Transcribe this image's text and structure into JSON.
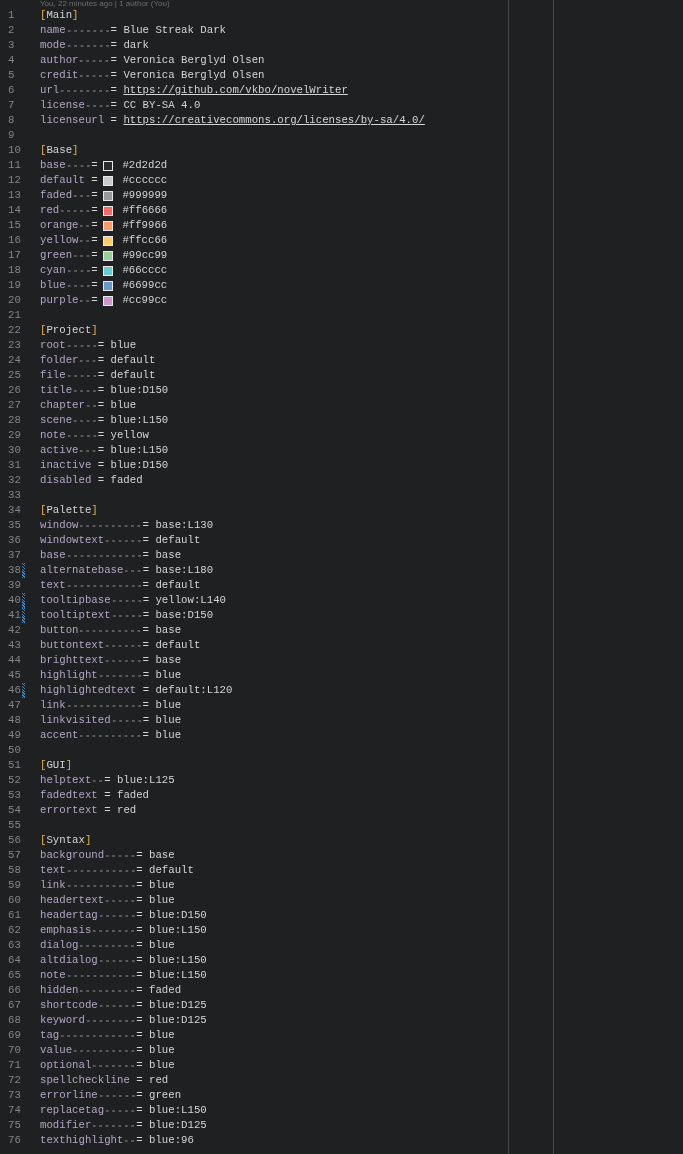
{
  "blame_hint": "You, 22 minutes ago | 1 author (You)",
  "lines": [
    {
      "number": "1",
      "kind": "section",
      "open": "[",
      "name": "Main",
      "close": "]",
      "modified": false
    },
    {
      "number": "2",
      "kind": "pair",
      "key": "name",
      "op": "=",
      "value": "Blue Streak Dark",
      "link": false,
      "modified": false
    },
    {
      "number": "3",
      "kind": "pair",
      "key": "mode",
      "op": "=",
      "value": "dark",
      "link": false,
      "modified": false
    },
    {
      "number": "4",
      "kind": "pair",
      "key": "author",
      "op": "=",
      "value": "Veronica Berglyd Olsen",
      "link": false,
      "modified": false
    },
    {
      "number": "5",
      "kind": "pair",
      "key": "credit",
      "op": "=",
      "value": "Veronica Berglyd Olsen",
      "link": false,
      "modified": false
    },
    {
      "number": "6",
      "kind": "pair",
      "key": "url",
      "op": "=",
      "value": "https://github.com/vkbo/novelWriter",
      "link": true,
      "modified": false
    },
    {
      "number": "7",
      "kind": "pair",
      "key": "license",
      "op": "=",
      "value": "CC BY-SA 4.0",
      "link": false,
      "modified": false
    },
    {
      "number": "8",
      "kind": "pair",
      "key": "licenseurl",
      "op": "=",
      "value": "https://creativecommons.org/licenses/by-sa/4.0/",
      "link": true,
      "modified": false
    },
    {
      "number": "9",
      "kind": "blank",
      "modified": false
    },
    {
      "number": "10",
      "kind": "section",
      "open": "[",
      "name": "Base",
      "close": "]",
      "modified": false
    },
    {
      "number": "11",
      "kind": "pair",
      "key": "base",
      "op": "=",
      "value": "#2d2d2d",
      "color": "#2d2d2d",
      "link": false,
      "modified": false
    },
    {
      "number": "12",
      "kind": "pair",
      "key": "default",
      "op": "=",
      "value": "#cccccc",
      "color": "#cccccc",
      "link": false,
      "modified": false
    },
    {
      "number": "13",
      "kind": "pair",
      "key": "faded",
      "op": "=",
      "value": "#999999",
      "color": "#999999",
      "link": false,
      "modified": false
    },
    {
      "number": "14",
      "kind": "pair",
      "key": "red",
      "op": "=",
      "value": "#ff6666",
      "color": "#ff6666",
      "link": false,
      "modified": false
    },
    {
      "number": "15",
      "kind": "pair",
      "key": "orange",
      "op": "=",
      "value": "#ff9966",
      "color": "#ff9966",
      "link": false,
      "modified": false
    },
    {
      "number": "16",
      "kind": "pair",
      "key": "yellow",
      "op": "=",
      "value": "#ffcc66",
      "color": "#ffcc66",
      "link": false,
      "modified": false
    },
    {
      "number": "17",
      "kind": "pair",
      "key": "green",
      "op": "=",
      "value": "#99cc99",
      "color": "#99cc99",
      "link": false,
      "modified": false
    },
    {
      "number": "18",
      "kind": "pair",
      "key": "cyan",
      "op": "=",
      "value": "#66cccc",
      "color": "#66cccc",
      "link": false,
      "modified": false
    },
    {
      "number": "19",
      "kind": "pair",
      "key": "blue",
      "op": "=",
      "value": "#6699cc",
      "color": "#6699cc",
      "link": false,
      "modified": false
    },
    {
      "number": "20",
      "kind": "pair",
      "key": "purple",
      "op": "=",
      "value": "#cc99cc",
      "color": "#cc99cc",
      "link": false,
      "modified": false
    },
    {
      "number": "21",
      "kind": "blank",
      "modified": false
    },
    {
      "number": "22",
      "kind": "section",
      "open": "[",
      "name": "Project",
      "close": "]",
      "modified": false
    },
    {
      "number": "23",
      "kind": "pair",
      "key": "root",
      "op": "=",
      "value": "blue",
      "link": false,
      "modified": false
    },
    {
      "number": "24",
      "kind": "pair",
      "key": "folder",
      "op": "=",
      "value": "default",
      "link": false,
      "modified": false
    },
    {
      "number": "25",
      "kind": "pair",
      "key": "file",
      "op": "=",
      "value": "default",
      "link": false,
      "modified": false
    },
    {
      "number": "26",
      "kind": "pair",
      "key": "title",
      "op": "=",
      "value": "blue:D150",
      "link": false,
      "modified": false
    },
    {
      "number": "27",
      "kind": "pair",
      "key": "chapter",
      "op": "=",
      "value": "blue",
      "link": false,
      "modified": false
    },
    {
      "number": "28",
      "kind": "pair",
      "key": "scene",
      "op": "=",
      "value": "blue:L150",
      "link": false,
      "modified": false
    },
    {
      "number": "29",
      "kind": "pair",
      "key": "note",
      "op": "=",
      "value": "yellow",
      "link": false,
      "modified": false
    },
    {
      "number": "30",
      "kind": "pair",
      "key": "active",
      "op": "=",
      "value": "blue:L150",
      "link": false,
      "modified": false
    },
    {
      "number": "31",
      "kind": "pair",
      "key": "inactive",
      "op": "=",
      "value": "blue:D150",
      "link": false,
      "modified": false
    },
    {
      "number": "32",
      "kind": "pair",
      "key": "disabled",
      "op": "=",
      "value": "faded",
      "link": false,
      "modified": false
    },
    {
      "number": "33",
      "kind": "blank",
      "modified": false
    },
    {
      "number": "34",
      "kind": "section",
      "open": "[",
      "name": "Palette",
      "close": "]",
      "modified": false
    },
    {
      "number": "35",
      "kind": "pair",
      "key": "window",
      "op": "=",
      "value": "base:L130",
      "link": false,
      "modified": false
    },
    {
      "number": "36",
      "kind": "pair",
      "key": "windowtext",
      "op": "=",
      "value": "default",
      "link": false,
      "modified": false
    },
    {
      "number": "37",
      "kind": "pair",
      "key": "base",
      "op": "=",
      "value": "base",
      "link": false,
      "modified": false
    },
    {
      "number": "38",
      "kind": "pair",
      "key": "alternatebase",
      "op": "=",
      "value": "base:L180",
      "link": false,
      "modified": true
    },
    {
      "number": "39",
      "kind": "pair",
      "key": "text",
      "op": "=",
      "value": "default",
      "link": false,
      "modified": false
    },
    {
      "number": "40",
      "kind": "pair",
      "key": "tooltipbase",
      "op": "=",
      "value": "yellow:L140",
      "link": false,
      "modified": true
    },
    {
      "number": "41",
      "kind": "pair",
      "key": "tooltiptext",
      "op": "=",
      "value": "base:D150",
      "link": false,
      "modified": true
    },
    {
      "number": "42",
      "kind": "pair",
      "key": "button",
      "op": "=",
      "value": "base",
      "link": false,
      "modified": false
    },
    {
      "number": "43",
      "kind": "pair",
      "key": "buttontext",
      "op": "=",
      "value": "default",
      "link": false,
      "modified": false
    },
    {
      "number": "44",
      "kind": "pair",
      "key": "brighttext",
      "op": "=",
      "value": "base",
      "link": false,
      "modified": false
    },
    {
      "number": "45",
      "kind": "pair",
      "key": "highlight",
      "op": "=",
      "value": "blue",
      "link": false,
      "modified": false
    },
    {
      "number": "46",
      "kind": "pair",
      "key": "highlightedtext",
      "op": "=",
      "value": "default:L120",
      "link": false,
      "modified": true
    },
    {
      "number": "47",
      "kind": "pair",
      "key": "link",
      "op": "=",
      "value": "blue",
      "link": false,
      "modified": false
    },
    {
      "number": "48",
      "kind": "pair",
      "key": "linkvisited",
      "op": "=",
      "value": "blue",
      "link": false,
      "modified": false
    },
    {
      "number": "49",
      "kind": "pair",
      "key": "accent",
      "op": "=",
      "value": "blue",
      "link": false,
      "modified": false
    },
    {
      "number": "50",
      "kind": "blank",
      "modified": false
    },
    {
      "number": "51",
      "kind": "section",
      "open": "[",
      "name": "GUI",
      "close": "]",
      "modified": false
    },
    {
      "number": "52",
      "kind": "pair",
      "key": "helptext",
      "op": "=",
      "value": "blue:L125",
      "link": false,
      "modified": false
    },
    {
      "number": "53",
      "kind": "pair",
      "key": "fadedtext",
      "op": "=",
      "value": "faded",
      "link": false,
      "modified": false
    },
    {
      "number": "54",
      "kind": "pair",
      "key": "errortext",
      "op": "=",
      "value": "red",
      "link": false,
      "modified": false
    },
    {
      "number": "55",
      "kind": "blank",
      "modified": false
    },
    {
      "number": "56",
      "kind": "section",
      "open": "[",
      "name": "Syntax",
      "close": "]",
      "modified": false
    },
    {
      "number": "57",
      "kind": "pair",
      "key": "background",
      "op": "=",
      "value": "base",
      "link": false,
      "modified": false
    },
    {
      "number": "58",
      "kind": "pair",
      "key": "text",
      "op": "=",
      "value": "default",
      "link": false,
      "modified": false
    },
    {
      "number": "59",
      "kind": "pair",
      "key": "link",
      "op": "=",
      "value": "blue",
      "link": false,
      "modified": false
    },
    {
      "number": "60",
      "kind": "pair",
      "key": "headertext",
      "op": "=",
      "value": "blue",
      "link": false,
      "modified": false
    },
    {
      "number": "61",
      "kind": "pair",
      "key": "headertag",
      "op": "=",
      "value": "blue:D150",
      "link": false,
      "modified": false
    },
    {
      "number": "62",
      "kind": "pair",
      "key": "emphasis",
      "op": "=",
      "value": "blue:L150",
      "link": false,
      "modified": false
    },
    {
      "number": "63",
      "kind": "pair",
      "key": "dialog",
      "op": "=",
      "value": "blue",
      "link": false,
      "modified": false
    },
    {
      "number": "64",
      "kind": "pair",
      "key": "altdialog",
      "op": "=",
      "value": "blue:L150",
      "link": false,
      "modified": false
    },
    {
      "number": "65",
      "kind": "pair",
      "key": "note",
      "op": "=",
      "value": "blue:L150",
      "link": false,
      "modified": false
    },
    {
      "number": "66",
      "kind": "pair",
      "key": "hidden",
      "op": "=",
      "value": "faded",
      "link": false,
      "modified": false
    },
    {
      "number": "67",
      "kind": "pair",
      "key": "shortcode",
      "op": "=",
      "value": "blue:D125",
      "link": false,
      "modified": false
    },
    {
      "number": "68",
      "kind": "pair",
      "key": "keyword",
      "op": "=",
      "value": "blue:D125",
      "link": false,
      "modified": false
    },
    {
      "number": "69",
      "kind": "pair",
      "key": "tag",
      "op": "=",
      "value": "blue",
      "link": false,
      "modified": false
    },
    {
      "number": "70",
      "kind": "pair",
      "key": "value",
      "op": "=",
      "value": "blue",
      "link": false,
      "modified": false
    },
    {
      "number": "71",
      "kind": "pair",
      "key": "optional",
      "op": "=",
      "value": "blue",
      "link": false,
      "modified": false
    },
    {
      "number": "72",
      "kind": "pair",
      "key": "spellcheckline",
      "op": "=",
      "value": "red",
      "link": false,
      "modified": false
    },
    {
      "number": "73",
      "kind": "pair",
      "key": "errorline",
      "op": "=",
      "value": "green",
      "link": false,
      "modified": false
    },
    {
      "number": "74",
      "kind": "pair",
      "key": "replacetag",
      "op": "=",
      "value": "blue:L150",
      "link": false,
      "modified": false
    },
    {
      "number": "75",
      "kind": "pair",
      "key": "modifier",
      "op": "=",
      "value": "blue:D125",
      "link": false,
      "modified": false
    },
    {
      "number": "76",
      "kind": "pair",
      "key": "texthighlight",
      "op": "=",
      "value": "blue:96",
      "link": false,
      "modified": false
    }
  ]
}
